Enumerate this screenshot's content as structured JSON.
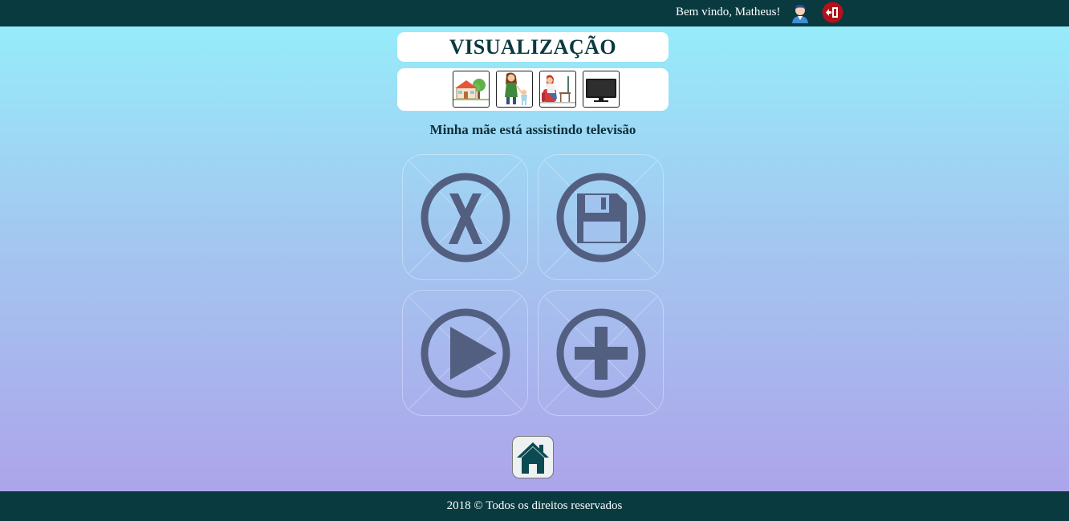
{
  "header": {
    "welcome_text": "Bem vindo, Matheus!",
    "user_icon": "user-avatar-icon",
    "logout_icon": "logout-icon",
    "bar_color": "#083a40",
    "logout_color": "#b3121a"
  },
  "title": "VISUALIZAÇÃO",
  "pictograms": [
    {
      "name": "house-pictogram"
    },
    {
      "name": "mother-pictogram"
    },
    {
      "name": "watching-pictogram"
    },
    {
      "name": "television-pictogram"
    }
  ],
  "sentence": "Minha mãe está assistindo televisão",
  "actions": [
    {
      "name": "cancel-button",
      "icon": "close-circle-icon"
    },
    {
      "name": "save-button",
      "icon": "floppy-disk-icon"
    },
    {
      "name": "play-button",
      "icon": "play-icon"
    },
    {
      "name": "add-button",
      "icon": "plus-icon"
    }
  ],
  "action_icon_color": "#535f80",
  "home_icon": "home-icon",
  "footer": {
    "text": "2018 © Todos os direitos reservados"
  }
}
